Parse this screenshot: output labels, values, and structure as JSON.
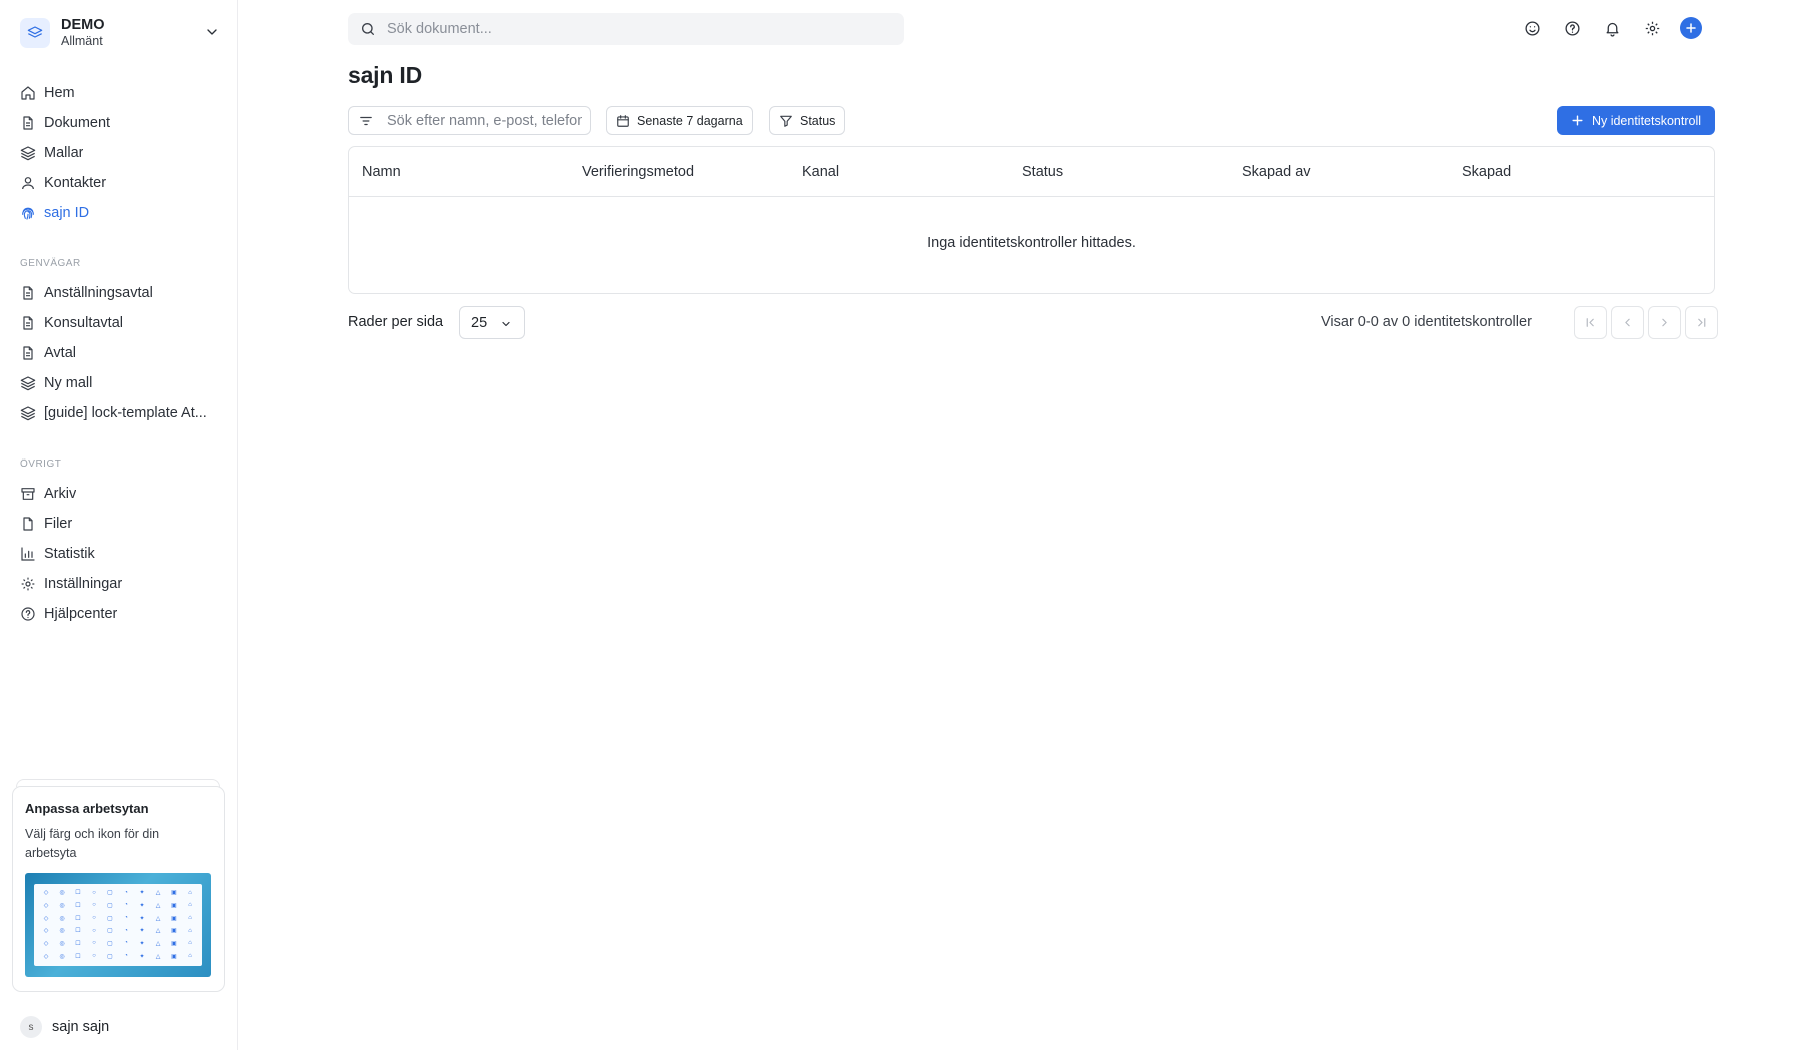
{
  "workspace": {
    "name": "DEMO",
    "subtitle": "Allmänt"
  },
  "sidebar": {
    "main_items": [
      {
        "label": "Hem",
        "icon": "home-icon"
      },
      {
        "label": "Dokument",
        "icon": "document-icon"
      },
      {
        "label": "Mallar",
        "icon": "layers-icon"
      },
      {
        "label": "Kontakter",
        "icon": "user-icon"
      },
      {
        "label": "sajn ID",
        "icon": "fingerprint-icon",
        "active": true
      }
    ],
    "shortcuts_label": "GENVÄGAR",
    "shortcuts": [
      {
        "label": "Anställningsavtal",
        "icon": "document-icon"
      },
      {
        "label": "Konsultavtal",
        "icon": "document-icon"
      },
      {
        "label": "Avtal",
        "icon": "document-icon"
      },
      {
        "label": "Ny mall",
        "icon": "layers-icon"
      },
      {
        "label": "[guide] lock-template At...",
        "icon": "layers-icon"
      }
    ],
    "other_label": "ÖVRIGT",
    "other": [
      {
        "label": "Arkiv",
        "icon": "archive-icon"
      },
      {
        "label": "Filer",
        "icon": "file-icon"
      },
      {
        "label": "Statistik",
        "icon": "bar-chart-icon"
      },
      {
        "label": "Inställningar",
        "icon": "gear-icon"
      },
      {
        "label": "Hjälpcenter",
        "icon": "help-circle-icon"
      }
    ],
    "promo": {
      "title": "Anpassa arbetsytan",
      "description": "Välj färg och ikon för din arbetsyta"
    },
    "user": {
      "initial": "s",
      "name": "sajn sajn"
    }
  },
  "search": {
    "placeholder": "Sök dokument..."
  },
  "topbar_icons": [
    "smile-icon",
    "help-circle-icon",
    "bell-icon",
    "gear-icon",
    "plus-circle-icon"
  ],
  "page": {
    "title": "sajn ID",
    "filter_placeholder": "Sök efter namn, e-post, telefon",
    "date_filter": "Senaste 7 dagarna",
    "status_filter": "Status",
    "new_button": "Ny identitetskontroll"
  },
  "table": {
    "columns": [
      "Namn",
      "Verifieringsmetod",
      "Kanal",
      "Status",
      "Skapad av",
      "Skapad"
    ],
    "empty_message": "Inga identitetskontroller hittades."
  },
  "pagination": {
    "rows_label": "Rader per sida",
    "rows_per_page": "25",
    "showing": "Visar 0-0 av 0 identitetskontroller"
  },
  "colors": {
    "accent": "#2f6fe4",
    "border": "#e3e5e8",
    "muted": "#9aa0a8"
  }
}
